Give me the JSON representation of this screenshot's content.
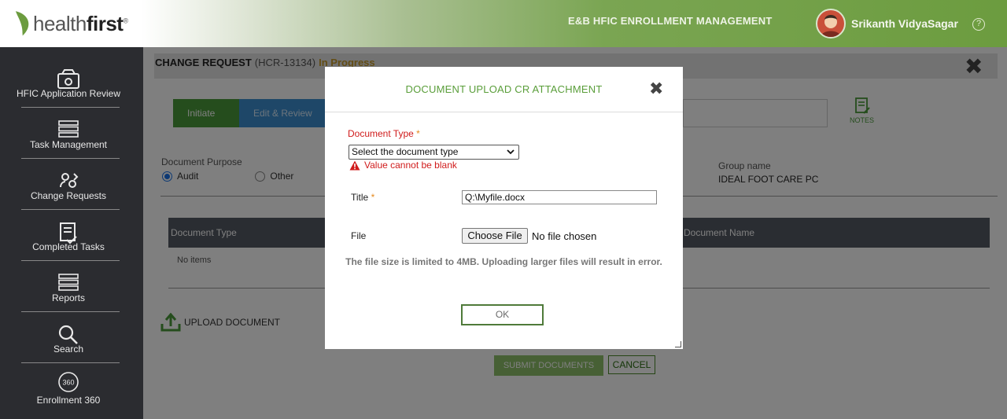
{
  "header": {
    "logo_light": "health",
    "logo_bold": "first",
    "logo_mark": "®",
    "app_title": "E&B HFIC ENROLLMENT MANAGEMENT",
    "user_name": "Srikanth VidyaSagar",
    "help_symbol": "?"
  },
  "sidebar": {
    "items": [
      {
        "label": "HFIC Application Review",
        "icon": "app-review-icon"
      },
      {
        "label": "Task Management",
        "icon": "server-stack-icon"
      },
      {
        "label": "Change Requests",
        "icon": "change-requests-icon"
      },
      {
        "label": "Completed Tasks",
        "icon": "checklist-icon"
      },
      {
        "label": "Reports",
        "icon": "server-stack-icon"
      },
      {
        "label": "Search",
        "icon": "search-icon"
      },
      {
        "label": "Enrollment 360",
        "icon": "enrollment-360-icon",
        "icon_text": "360"
      }
    ]
  },
  "page": {
    "title": "CHANGE REQUEST",
    "id": "(HCR-13134)",
    "status": "In Progress",
    "close_symbol": "✖",
    "steps": [
      {
        "label": "Initiate",
        "done": true
      },
      {
        "label": "Edit & Review",
        "done": false
      }
    ],
    "notes_label": "NOTES",
    "doc_purpose_label": "Document Purpose",
    "purpose_options": [
      {
        "label": "Audit",
        "selected": true
      },
      {
        "label": "Other",
        "selected": false
      }
    ],
    "group_name_label": "Group name",
    "group_name_value": "IDEAL FOOT CARE PC",
    "grid_columns": [
      "Document Type",
      "Document Name"
    ],
    "no_items": "No items",
    "upload_label": "UPLOAD DOCUMENT",
    "submit_label": "SUBMIT DOCUMENTS",
    "cancel_label": "CANCEL"
  },
  "modal": {
    "title": "DOCUMENT UPLOAD CR ATTACHMENT",
    "close_symbol": "✖",
    "doc_type_label": "Document Type",
    "required_marker": "*",
    "doc_type_value": "Select the document type",
    "error_text": "Value cannot be blank",
    "title_label": "Title",
    "title_value": "Q:\\Myfile.docx",
    "file_label": "File",
    "file_button": "Choose File",
    "file_status": "No file chosen",
    "size_note": "The file size is limited to 4MB. Uploading larger files will result in error.",
    "ok_label": "OK"
  },
  "colors": {
    "brand_green": "#6c9c3f",
    "sidebar_bg": "#2b2c30",
    "error_red": "#d01b1b",
    "modal_title_green": "#5a9e3a"
  }
}
